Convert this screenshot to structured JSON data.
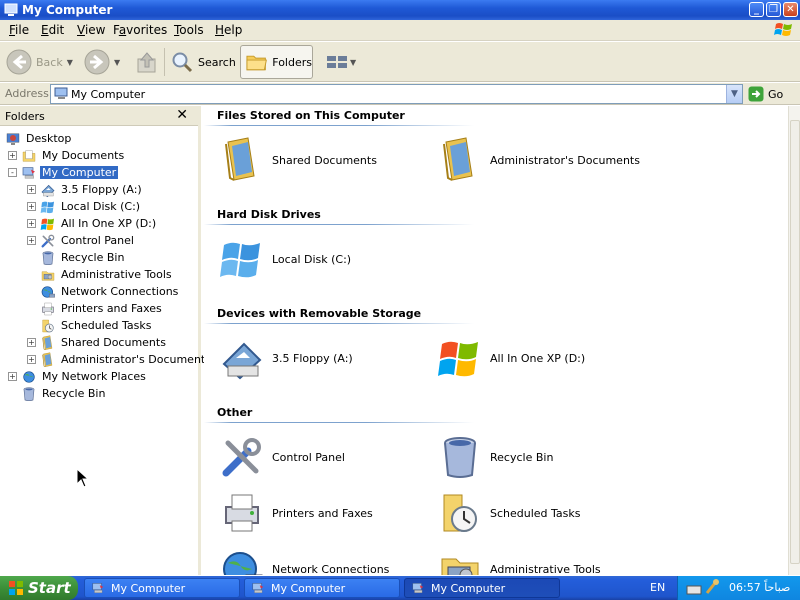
{
  "window": {
    "title": "My Computer"
  },
  "menu": [
    "File",
    "Edit",
    "View",
    "Favorites",
    "Tools",
    "Help"
  ],
  "menu_underline": [
    "F",
    "E",
    "V",
    "a",
    "T",
    "H"
  ],
  "toolbar": {
    "back": "Back",
    "search": "Search",
    "folders": "Folders"
  },
  "address": {
    "label": "Address",
    "value": "My Computer",
    "go": "Go"
  },
  "folders_pane": {
    "header": "Folders",
    "items": [
      {
        "label": "Desktop",
        "icon": "desktop-icon",
        "level": 0,
        "expander": ""
      },
      {
        "label": "My Documents",
        "icon": "my-documents-icon",
        "level": 1,
        "expander": "+"
      },
      {
        "label": "My Computer",
        "icon": "my-computer-icon",
        "level": 1,
        "expander": "-",
        "selected": true
      },
      {
        "label": "3.5 Floppy (A:)",
        "icon": "floppy-icon",
        "level": 2,
        "expander": "+"
      },
      {
        "label": "Local Disk (C:)",
        "icon": "local-disk-icon",
        "level": 2,
        "expander": "+"
      },
      {
        "label": "All In One XP (D:)",
        "icon": "cd-drive-icon",
        "level": 2,
        "expander": "+"
      },
      {
        "label": "Control Panel",
        "icon": "control-panel-icon",
        "level": 2,
        "expander": "+"
      },
      {
        "label": "Recycle Bin",
        "icon": "recycle-bin-icon",
        "level": 2,
        "expander": ""
      },
      {
        "label": "Administrative Tools",
        "icon": "admin-tools-icon",
        "level": 2,
        "expander": ""
      },
      {
        "label": "Network Connections",
        "icon": "network-connections-icon",
        "level": 2,
        "expander": ""
      },
      {
        "label": "Printers and Faxes",
        "icon": "printer-icon",
        "level": 2,
        "expander": ""
      },
      {
        "label": "Scheduled Tasks",
        "icon": "scheduled-tasks-icon",
        "level": 2,
        "expander": ""
      },
      {
        "label": "Shared Documents",
        "icon": "shared-folder-icon",
        "level": 2,
        "expander": "+"
      },
      {
        "label": "Administrator's Documents",
        "icon": "shared-folder-icon",
        "level": 2,
        "expander": "+"
      },
      {
        "label": "My Network Places",
        "icon": "network-places-icon",
        "level": 1,
        "expander": "+"
      },
      {
        "label": "Recycle Bin",
        "icon": "recycle-bin-icon",
        "level": 1,
        "expander": ""
      }
    ]
  },
  "groups": [
    {
      "title": "Files Stored on This Computer",
      "items": [
        {
          "label": "Shared Documents",
          "icon": "shared-folder-icon"
        },
        {
          "label": "Administrator's Documents",
          "icon": "shared-folder-icon"
        }
      ]
    },
    {
      "title": "Hard Disk Drives",
      "items": [
        {
          "label": "Local Disk (C:)",
          "icon": "local-disk-icon"
        }
      ]
    },
    {
      "title": "Devices with Removable Storage",
      "items": [
        {
          "label": "3.5 Floppy (A:)",
          "icon": "floppy-icon"
        },
        {
          "label": "All In One XP (D:)",
          "icon": "cd-drive-icon"
        }
      ]
    },
    {
      "title": "Other",
      "items": [
        {
          "label": "Control Panel",
          "icon": "control-panel-icon"
        },
        {
          "label": "Recycle Bin",
          "icon": "recycle-bin-icon"
        },
        {
          "label": "Printers and Faxes",
          "icon": "printer-icon"
        },
        {
          "label": "Scheduled Tasks",
          "icon": "scheduled-tasks-icon"
        },
        {
          "label": "Network Connections",
          "icon": "network-connections-icon"
        },
        {
          "label": "Administrative Tools",
          "icon": "admin-tools-icon"
        }
      ]
    }
  ],
  "taskbar": {
    "start": "Start",
    "tasks": [
      {
        "label": "My Computer"
      },
      {
        "label": "My Computer"
      },
      {
        "label": "My Computer",
        "active": true
      }
    ],
    "language": "EN",
    "clock": "06:57 صباحاً"
  }
}
